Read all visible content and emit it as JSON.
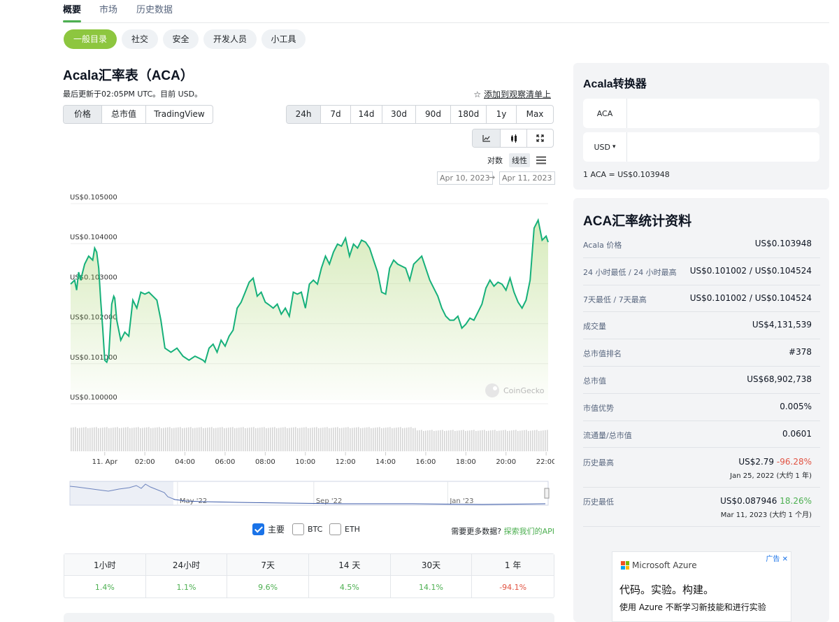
{
  "top_tabs": [
    "概要",
    "市场",
    "历史数据"
  ],
  "pills": [
    "一般目录",
    "社交",
    "安全",
    "开发人员",
    "小工具"
  ],
  "title": "Acala汇率表（ACA）",
  "updated": "最后更新于02:05PM UTC。目前 USD。",
  "watchlist": {
    "icon": "star-icon",
    "label": "添加到观察清单上"
  },
  "chart_tabs": [
    "价格",
    "总市值",
    "TradingView"
  ],
  "ranges": [
    "24h",
    "7d",
    "14d",
    "30d",
    "90d",
    "180d",
    "1y",
    "Max"
  ],
  "tools": [
    "line-chart-icon",
    "candlestick-icon",
    "fullscreen-icon"
  ],
  "scale": {
    "log": "对数",
    "linear": "线性",
    "menu_icon": "menu-icon"
  },
  "date_from": "Apr 10, 2023",
  "date_arrow": "→",
  "date_to": "Apr 11, 2023",
  "watermark": "CoinGecko",
  "chart_data": {
    "type": "area",
    "y_axis_labels": [
      "US$0.105000",
      "US$0.104000",
      "US$0.103000",
      "US$0.102000",
      "US$0.101000",
      "US$0.100000"
    ],
    "ylim": [
      0.1,
      0.105
    ],
    "x_ticks": [
      {
        "label": "11. Apr",
        "h": 0
      },
      {
        "label": "02:00",
        "h": 2
      },
      {
        "label": "04:00",
        "h": 4
      },
      {
        "label": "06:00",
        "h": 6
      },
      {
        "label": "08:00",
        "h": 8
      },
      {
        "label": "10:00",
        "h": 10
      },
      {
        "label": "12:00",
        "h": 12
      },
      {
        "label": "14:00",
        "h": 14
      },
      {
        "label": "16:00",
        "h": 16
      },
      {
        "label": "18:00",
        "h": 18
      },
      {
        "label": "20:00",
        "h": 20
      },
      {
        "label": "22:00",
        "h": 22
      }
    ],
    "x_range_hours": [
      -1.7,
      22.1
    ],
    "x_hours": [
      -1.7,
      -1.5,
      -1.4,
      -1.3,
      -1.2,
      -1.0,
      -0.8,
      -0.6,
      -0.5,
      -0.4,
      -0.3,
      -0.2,
      -0.1,
      0.0,
      0.1,
      0.2,
      0.35,
      0.45,
      0.5,
      0.6,
      0.8,
      1.0,
      1.2,
      1.4,
      1.6,
      1.8,
      2.0,
      2.2,
      2.4,
      2.6,
      2.8,
      3.0,
      3.3,
      3.6,
      3.9,
      4.2,
      4.5,
      4.7,
      4.9,
      5.0,
      5.2,
      5.4,
      5.6,
      5.8,
      6.0,
      6.2,
      6.4,
      6.6,
      6.8,
      7.0,
      7.2,
      7.4,
      7.6,
      7.8,
      8.0,
      8.2,
      8.4,
      8.6,
      8.8,
      9.0,
      9.2,
      9.4,
      9.6,
      9.8,
      10.0,
      10.2,
      10.4,
      10.6,
      10.8,
      11.0,
      11.2,
      11.4,
      11.6,
      11.8,
      12.0,
      12.2,
      12.4,
      12.6,
      12.8,
      13.0,
      13.2,
      13.4,
      13.6,
      13.8,
      14.0,
      14.2,
      14.4,
      14.6,
      14.8,
      15.0,
      15.2,
      15.4,
      15.6,
      15.8,
      16.0,
      16.2,
      16.4,
      16.6,
      16.8,
      17.0,
      17.2,
      17.4,
      17.6,
      17.8,
      18.0,
      18.2,
      18.4,
      18.6,
      18.8,
      19.0,
      19.2,
      19.4,
      19.6,
      19.8,
      20.0,
      20.2,
      20.4,
      20.6,
      20.8,
      21.0,
      21.2,
      21.4,
      21.6,
      21.8,
      22.0,
      22.1
    ],
    "values": [
      0.1029,
      0.103,
      0.10275,
      0.1032,
      0.103,
      0.1034,
      0.1036,
      0.1035,
      0.1038,
      0.1037,
      0.1033,
      0.1025,
      0.1018,
      0.101,
      0.10095,
      0.1011,
      0.1024,
      0.1026,
      0.10255,
      0.102,
      0.1015,
      0.1017,
      0.1016,
      0.1025,
      0.1023,
      0.1027,
      0.10265,
      0.1027,
      0.1026,
      0.1025,
      0.102,
      0.1013,
      0.1012,
      0.1013,
      0.1011,
      0.101,
      0.1011,
      0.10105,
      0.101,
      0.10095,
      0.1013,
      0.1014,
      0.1012,
      0.1015,
      0.10135,
      0.1016,
      0.10175,
      0.1023,
      0.10245,
      0.1027,
      0.10295,
      0.10305,
      0.1026,
      0.1027,
      0.10245,
      0.10238,
      0.1023,
      0.1024,
      0.10215,
      0.1023,
      0.1021,
      0.1027,
      0.10265,
      0.1027,
      0.1023,
      0.1029,
      0.103,
      0.1029,
      0.1033,
      0.1036,
      0.1034,
      0.1037,
      0.1039,
      0.10385,
      0.10405,
      0.1036,
      0.1039,
      0.1038,
      0.104,
      0.10395,
      0.1038,
      0.1035,
      0.1032,
      0.1027,
      0.10265,
      0.1033,
      0.1035,
      0.1034,
      0.10335,
      0.1033,
      0.103,
      0.1034,
      0.1035,
      0.1036,
      0.1033,
      0.103,
      0.1028,
      0.1026,
      0.1023,
      0.1021,
      0.102,
      0.102,
      0.1021,
      0.1018,
      0.1019,
      0.10205,
      0.102,
      0.1022,
      0.1024,
      0.1028,
      0.103,
      0.10285,
      0.10295,
      0.1029,
      0.10275,
      0.10305,
      0.1027,
      0.10245,
      0.1023,
      0.1025,
      0.103,
      0.1043,
      0.1045,
      0.104,
      0.1041,
      0.10395
    ],
    "volume": "uniform",
    "navigator_labels": [
      {
        "label": "May '22",
        "pos": 0.225
      },
      {
        "label": "Sep '22",
        "pos": 0.51
      },
      {
        "label": "Jan '23",
        "pos": 0.79
      }
    ]
  },
  "legend": [
    {
      "label": "主要",
      "checked": true
    },
    {
      "label": "BTC",
      "checked": false
    },
    {
      "label": "ETH",
      "checked": false
    }
  ],
  "more_data": {
    "prefix": "需要更多数据?",
    "link": "探索我们的API"
  },
  "performance": {
    "headers": [
      "1小时",
      "24小时",
      "7天",
      "14 天",
      "30天",
      "1 年"
    ],
    "values": [
      "1.4%",
      "1.1%",
      "9.6%",
      "4.5%",
      "14.1%",
      "-94.1%"
    ],
    "trend": [
      "up",
      "up",
      "up",
      "up",
      "up",
      "down"
    ]
  },
  "converter": {
    "title": "Acala转换器",
    "from_currency": "ACA",
    "to_currency": "USD",
    "to_caret": "▾",
    "rate": "1 ACA = US$0.103948"
  },
  "stats": {
    "title": "ACA汇率统计资料",
    "rows": [
      {
        "label": "Acala 价格",
        "value": "US$0.103948"
      },
      {
        "label": "24 小时最低 / 24 小时最高",
        "value": "US$0.101002 / US$0.104524"
      },
      {
        "label": "7天最低 / 7天最高",
        "value": "US$0.101002 / US$0.104524"
      },
      {
        "label": "成交量",
        "value": "US$4,131,539"
      },
      {
        "label": "总市值排名",
        "value": "#378"
      },
      {
        "label": "总市值",
        "value": "US$68,902,738"
      },
      {
        "label": "市值优势",
        "value": "0.005%"
      },
      {
        "label": "流通量/总市值",
        "value": "0.0601"
      }
    ],
    "ath": {
      "label": "历史最高",
      "value": "US$2.79",
      "change": "-96.28%",
      "date": "Jan 25, 2022 (大约 1 年)"
    },
    "atl": {
      "label": "历史最低",
      "value": "US$0.087946",
      "change": "18.26%",
      "date": "Mar 11, 2023 (大约 1 个月)"
    }
  },
  "ad": {
    "badge": "广告",
    "brand": "Microsoft Azure",
    "headline": "代码。实验。构建。",
    "body": "使用 Azure 不断学习新技能和进行实验"
  }
}
